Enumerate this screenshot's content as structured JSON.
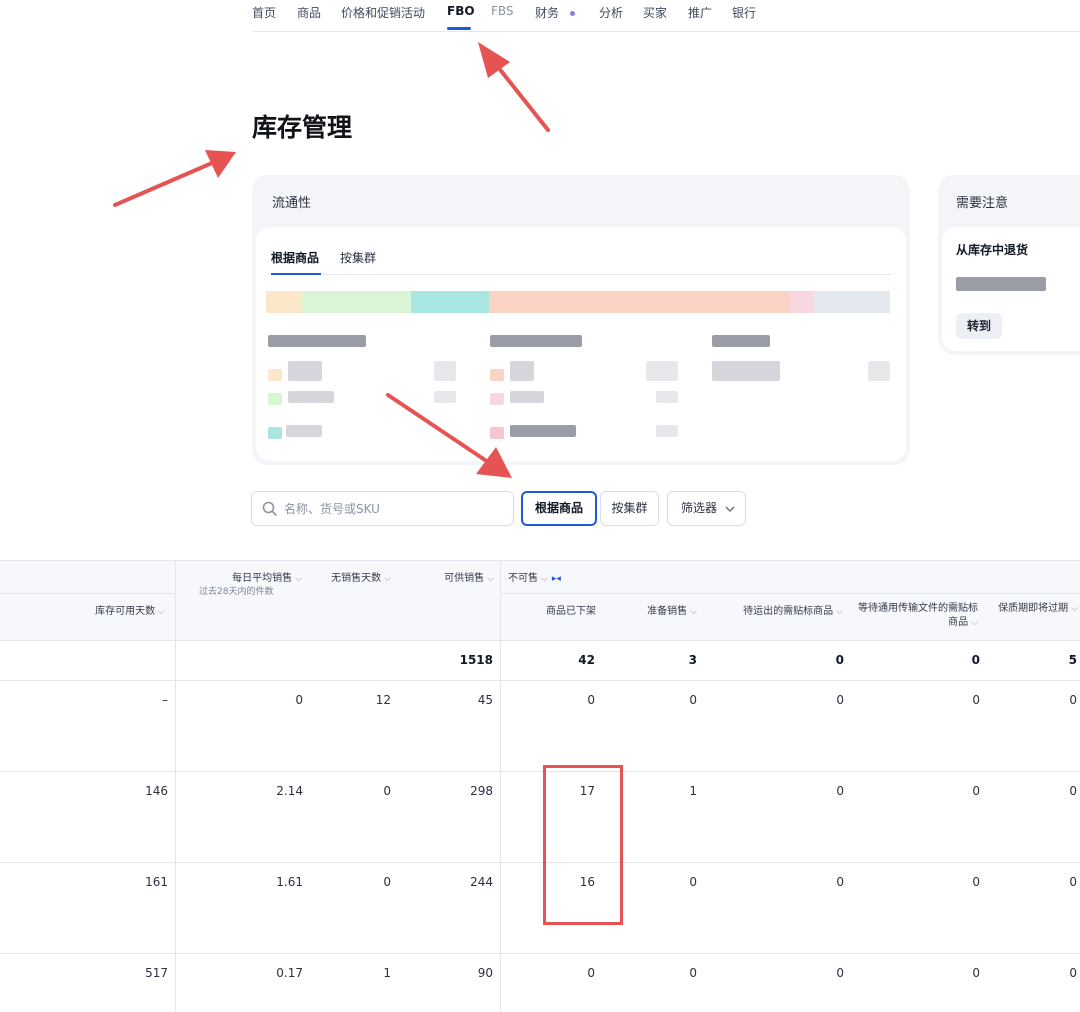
{
  "nav": {
    "items": [
      "首页",
      "商品",
      "价格和促销活动",
      "FBO",
      "FBS",
      "财务",
      "分析",
      "买家",
      "推广",
      "银行"
    ],
    "active": "FBO"
  },
  "page": {
    "title": "库存管理"
  },
  "liquidity": {
    "title": "流通性",
    "tabs": [
      "根据商品",
      "按集群"
    ],
    "bar_colors": [
      "#fde7c9",
      "#d9f5d6",
      "#a9e6e1",
      "#fbd3c5",
      "#f9d7e0",
      "#e3e8ef"
    ]
  },
  "attention": {
    "title": "需要注意",
    "subtitle": "从库存中退货",
    "goto_label": "转到"
  },
  "toolbar": {
    "search_placeholder": "名称、货号或SKU",
    "by_product": "根据商品",
    "by_cluster": "按集群",
    "filter": "筛选器"
  },
  "table": {
    "headers": {
      "days_available": "库存可用天数",
      "avg_daily_sales": "每日平均销售",
      "avg_daily_sales_sub": "过去28天内的件数",
      "days_no_sales": "无销售天数",
      "available_for_sale": "可供销售",
      "not_for_sale": "不可售",
      "delisted": "商品已下架",
      "preparing_sale": "准备销售",
      "awaiting_label": "待运出的需贴标商品",
      "awaiting_docs": "等待通用传输文件的需贴标商品",
      "expiring": "保质期即将过期"
    },
    "totals": {
      "available_for_sale": "1518",
      "delisted": "42",
      "preparing_sale": "3",
      "awaiting_label": "0",
      "awaiting_docs": "0",
      "expiring": "5"
    },
    "rows": [
      {
        "days_available": "–",
        "avg_daily_sales": "0",
        "days_no_sales": "12",
        "available_for_sale": "45",
        "delisted": "0",
        "preparing_sale": "0",
        "awaiting_label": "0",
        "awaiting_docs": "0",
        "expiring": "0"
      },
      {
        "days_available": "146",
        "avg_daily_sales": "2.14",
        "days_no_sales": "0",
        "available_for_sale": "298",
        "delisted": "17",
        "preparing_sale": "1",
        "awaiting_label": "0",
        "awaiting_docs": "0",
        "expiring": "0"
      },
      {
        "days_available": "161",
        "avg_daily_sales": "1.61",
        "days_no_sales": "0",
        "available_for_sale": "244",
        "delisted": "16",
        "preparing_sale": "0",
        "awaiting_label": "0",
        "awaiting_docs": "0",
        "expiring": "0"
      },
      {
        "days_available": "517",
        "avg_daily_sales": "0.17",
        "days_no_sales": "1",
        "available_for_sale": "90",
        "delisted": "0",
        "preparing_sale": "0",
        "awaiting_label": "0",
        "awaiting_docs": "0",
        "expiring": "0"
      }
    ]
  },
  "colors": {
    "accent": "#1d5bd9",
    "annotation": "#e55353",
    "nav_dot": "#8e7ce8"
  }
}
